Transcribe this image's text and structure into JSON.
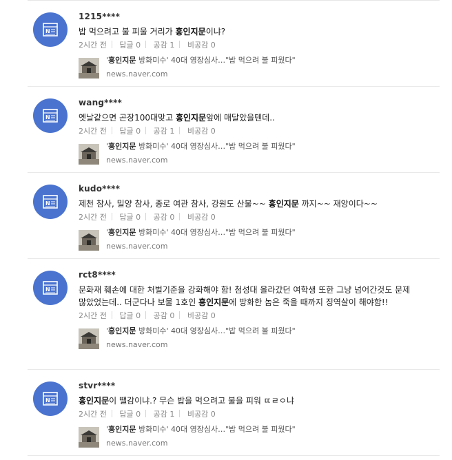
{
  "keyword": "흥인지문",
  "labels": {
    "reply": "답글",
    "like": "공감",
    "dislike": "비공감"
  },
  "article": {
    "title_prefix": "'",
    "title_keyword": "흥인지문",
    "title_rest": " 방화미수' 40대 영장심사…\"밥 먹으려 불 피웠다\"",
    "source": "news.naver.com"
  },
  "comments": [
    {
      "user": "1215****",
      "text_before": "밥 먹으려고 불 피울 거리가 ",
      "text_keyword": "흥인지문",
      "text_after": "이냐?",
      "time": "2시간 전",
      "replies": "0",
      "likes": "1",
      "dislikes": "0"
    },
    {
      "user": "wang****",
      "text_before": "옛날같으면 곤장100대맞고 ",
      "text_keyword": "흥인지문",
      "text_after": "앞에 매달았을텐데..",
      "time": "2시간 전",
      "replies": "0",
      "likes": "1",
      "dislikes": "0"
    },
    {
      "user": "kudo****",
      "text_before": "제천 참사, 밀양 참사, 종로 여관 참사, 강원도 산불~~ ",
      "text_keyword": "흥인지문",
      "text_after": " 까지~~ 재앙이다~~",
      "time": "2시간 전",
      "replies": "0",
      "likes": "0",
      "dislikes": "0"
    },
    {
      "user": "rct8****",
      "text_before": "문화재 훼손에 대한 처벌기준을 강화해야 함! 첨성대 올라갔던 여학생 또한 그냥 넘어간것도 문제 많았었는데.. 더군다나 보물 1호인 ",
      "text_keyword": "흥인지문",
      "text_after": "에 방화한 놈은 죽을 때까지 징역살이 해야함!!",
      "time": "2시간 전",
      "replies": "0",
      "likes": "0",
      "dislikes": "0"
    },
    {
      "user": "stvr****",
      "text_before": "",
      "text_keyword": "흥인지문",
      "text_after": "이 땔감이냐.? 무슨 밥을 먹으려고 불을 피워 ㄸㄹㅇ냐",
      "time": "2시간 전",
      "replies": "0",
      "likes": "1",
      "dislikes": "0"
    }
  ]
}
